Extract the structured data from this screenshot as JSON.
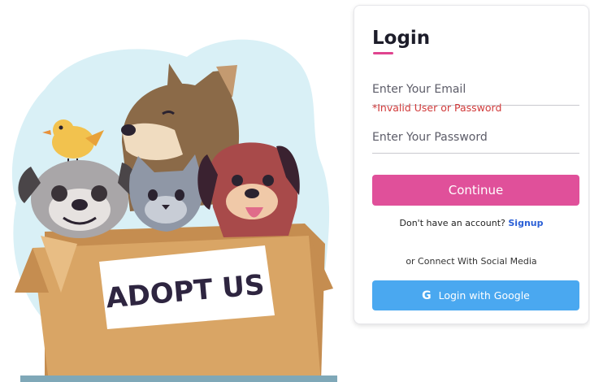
{
  "illustration": {
    "sign_text": "ADOPT US"
  },
  "login": {
    "title": "Login",
    "email_placeholder": "Enter Your Email",
    "error": "*Invalid User or Password",
    "password_placeholder": "Enter Your Password",
    "continue_label": "Continue",
    "no_account_text": "Don't have an account?",
    "signup_label": "Signup",
    "social_text": "or Connect With Social Media",
    "google_icon": "G",
    "google_label": "Login with Google"
  },
  "colors": {
    "accent": "#e0509a",
    "error": "#d13a3a",
    "link": "#2a5fd6",
    "google": "#4aa8f0"
  }
}
